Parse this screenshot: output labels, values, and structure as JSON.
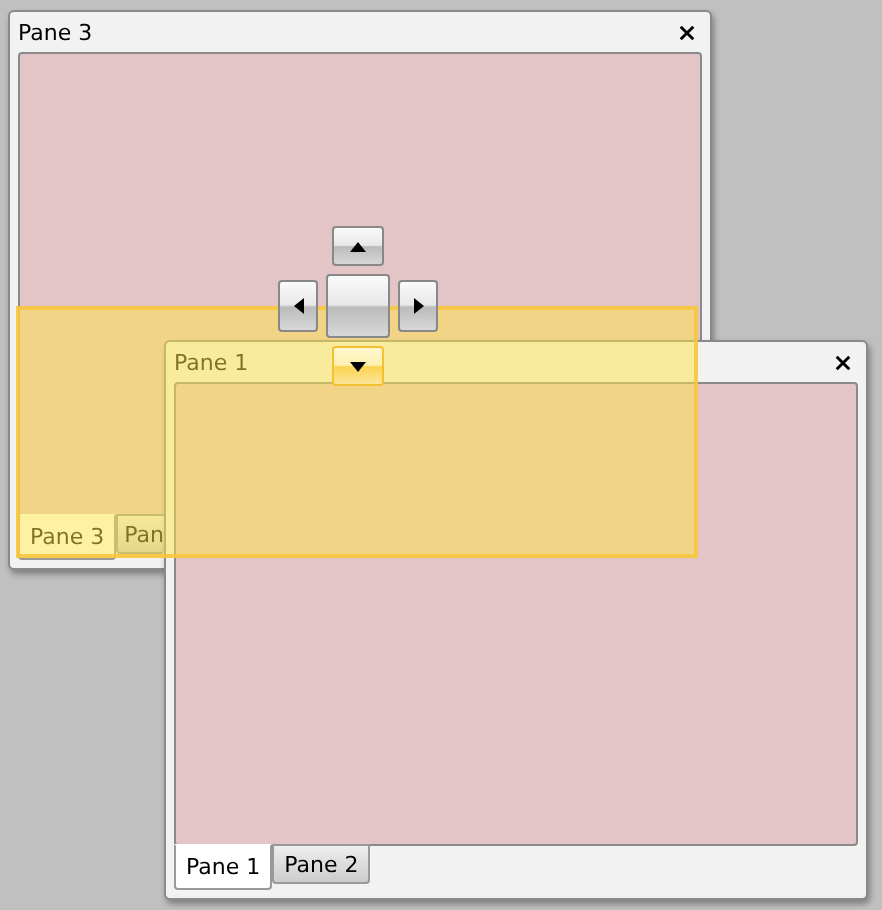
{
  "panes": [
    {
      "title": "Pane 3",
      "tabs": [
        {
          "label": "Pane 3",
          "selected": true
        },
        {
          "label": "Pan",
          "selected": false
        }
      ]
    },
    {
      "title": "Pane 1",
      "tabs": [
        {
          "label": "Pane 1",
          "selected": true
        },
        {
          "label": "Pane 2",
          "selected": false
        }
      ]
    }
  ],
  "drop_preview": {
    "shown": true
  },
  "dock_guide": {
    "buttons": [
      {
        "kind": "up",
        "selected": false
      },
      {
        "kind": "left",
        "selected": false
      },
      {
        "kind": "center",
        "selected": false
      },
      {
        "kind": "right",
        "selected": false
      },
      {
        "kind": "down",
        "selected": true
      }
    ]
  }
}
